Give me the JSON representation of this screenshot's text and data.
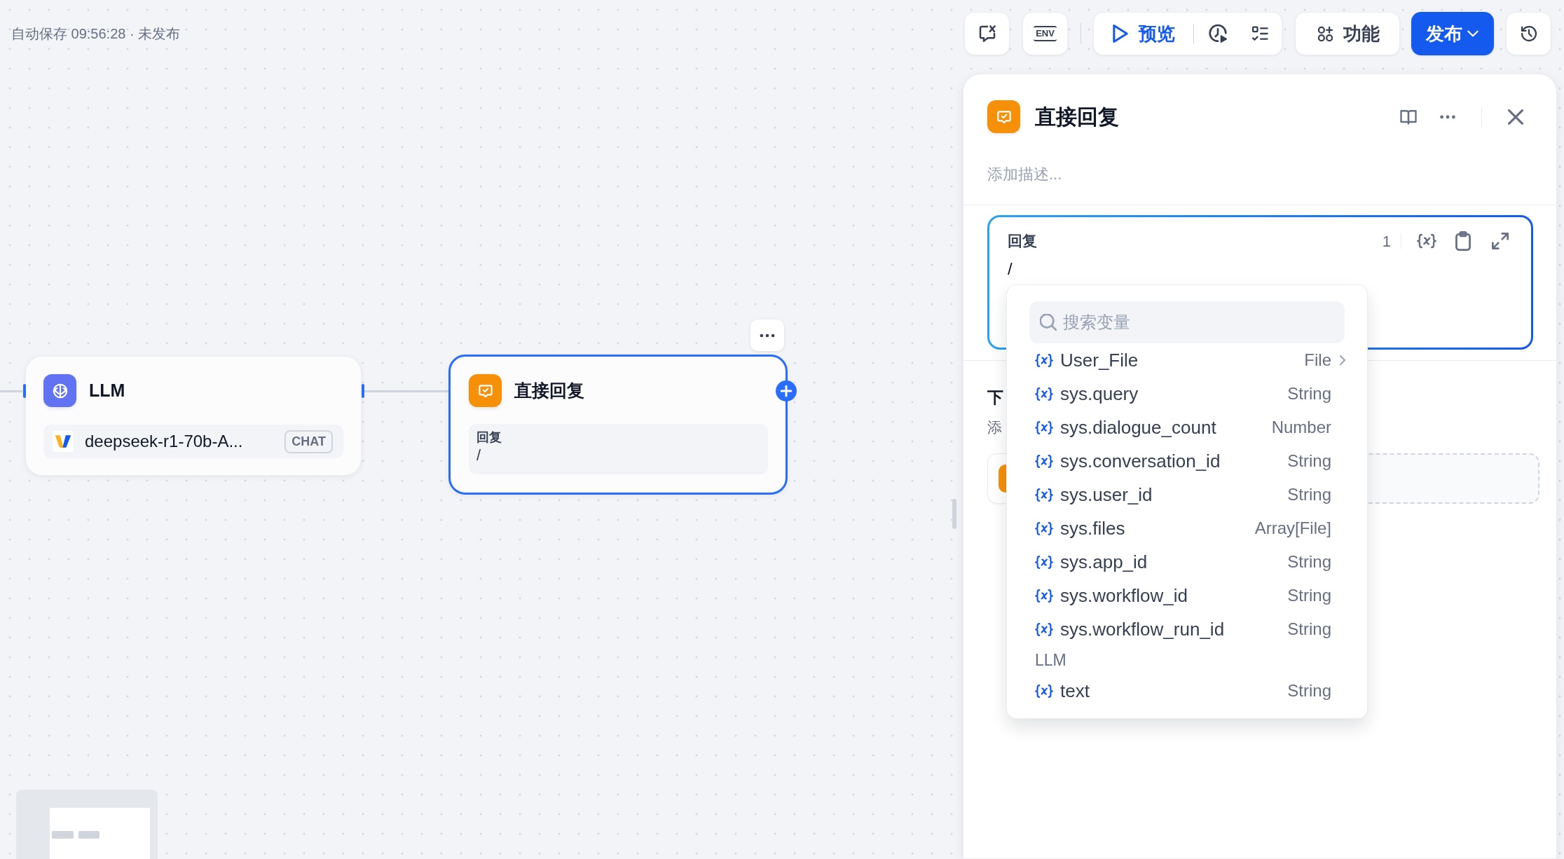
{
  "status": {
    "text": "自动保存 09:56:28 · 未发布"
  },
  "toolbar": {
    "env": "ENV",
    "preview": "预览",
    "features": "功能",
    "publish": "发布"
  },
  "canvas": {
    "nodes": [
      {
        "kind": "llm",
        "title": "LLM",
        "selected": false,
        "model": "deepseek-r1-70b-A...",
        "mode": "CHAT"
      },
      {
        "kind": "answer",
        "title": "直接回复",
        "selected": true,
        "field_label": "回复",
        "field_value": "/"
      }
    ]
  },
  "panel": {
    "title": "直接回复",
    "description": {
      "placeholder": "添加描述..."
    },
    "reply": {
      "label": "回复",
      "count": "1",
      "value": "/"
    },
    "next_step": {
      "title": "下",
      "description": "添"
    }
  },
  "variable_menu": {
    "search": {
      "placeholder": "搜索变量"
    },
    "groups": [
      {
        "items": [
          {
            "name": "User_File",
            "type": "File",
            "expandable": true
          },
          {
            "name": "sys.query",
            "type": "String",
            "expandable": false
          },
          {
            "name": "sys.dialogue_count",
            "type": "Number",
            "expandable": false
          },
          {
            "name": "sys.conversation_id",
            "type": "String",
            "expandable": false
          },
          {
            "name": "sys.user_id",
            "type": "String",
            "expandable": false
          },
          {
            "name": "sys.files",
            "type": "Array[File]",
            "expandable": false
          },
          {
            "name": "sys.app_id",
            "type": "String",
            "expandable": false
          },
          {
            "name": "sys.workflow_id",
            "type": "String",
            "expandable": false
          },
          {
            "name": "sys.workflow_run_id",
            "type": "String",
            "expandable": false
          }
        ]
      },
      {
        "title": "LLM",
        "items": [
          {
            "name": "text",
            "type": "String",
            "expandable": false
          }
        ]
      }
    ]
  }
}
